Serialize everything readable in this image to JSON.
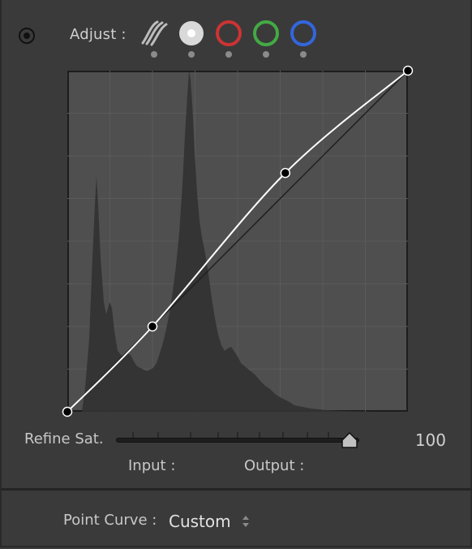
{
  "toolbar": {
    "adjust_label": "Adjust :",
    "channels": [
      {
        "name": "parametric-curve-icon",
        "selected": false
      },
      {
        "name": "rgb-channel-icon",
        "selected": true
      },
      {
        "name": "red-channel-icon",
        "selected": false
      },
      {
        "name": "green-channel-icon",
        "selected": false
      },
      {
        "name": "blue-channel-icon",
        "selected": false
      }
    ],
    "icon_target": "target-adjustment-icon"
  },
  "colors": {
    "panel_bg": "#3a3a3a",
    "curve_bg": "#4f4f4f",
    "histogram_fill": "#333333",
    "red": "#cc3333",
    "green": "#44aa44",
    "blue": "#3366dd",
    "curve_line": "#ffffff"
  },
  "curve": {
    "points": [
      {
        "input": 0,
        "output": 0
      },
      {
        "input": 25,
        "output": 25
      },
      {
        "input": 64,
        "output": 70
      },
      {
        "input": 100,
        "output": 100
      }
    ]
  },
  "refine": {
    "label": "Refine Sat.",
    "value": "100",
    "level": 1.0
  },
  "readouts": {
    "input_label": "Input :",
    "output_label": "Output :"
  },
  "point_curve": {
    "label": "Point Curve :",
    "value": "Custom"
  }
}
